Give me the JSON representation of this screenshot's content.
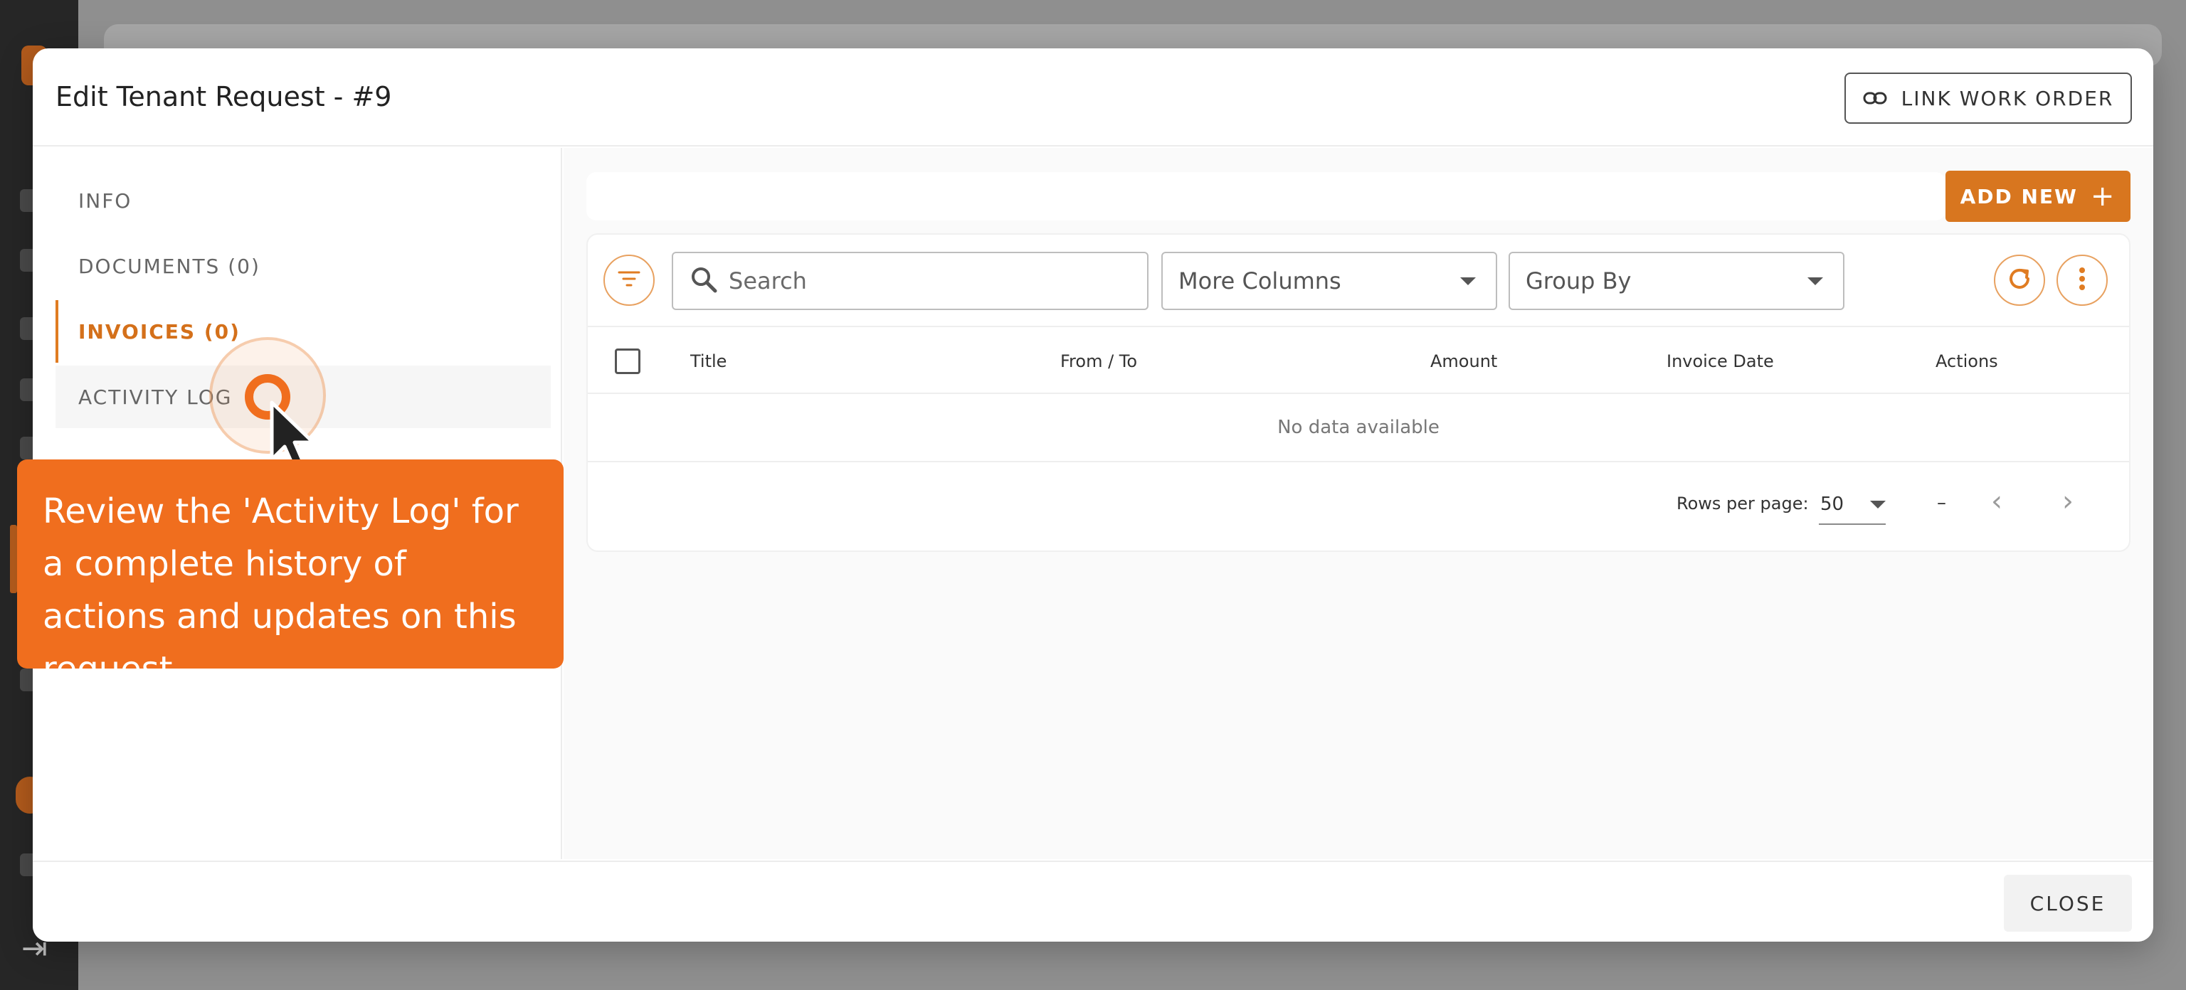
{
  "modal": {
    "title": "Edit Tenant Request - #9",
    "link_work_order": "LINK WORK ORDER",
    "close": "CLOSE"
  },
  "tabs": [
    {
      "label": "INFO"
    },
    {
      "label": "DOCUMENTS (0)"
    },
    {
      "label": "INVOICES (0)",
      "active": true
    },
    {
      "label": "ACTIVITY LOG"
    }
  ],
  "toolbar": {
    "add_new": "ADD NEW",
    "search_placeholder": "Search",
    "more_columns": "More Columns",
    "group_by": "Group By"
  },
  "table": {
    "columns": [
      "Title",
      "From / To",
      "Amount",
      "Invoice Date",
      "Actions"
    ],
    "empty_text": "No data available"
  },
  "pagination": {
    "rows_per_page_label": "Rows per page:",
    "rows_per_page": "50",
    "range": "–"
  },
  "tour": {
    "tooltip_text": "Review the 'Activity Log' for a complete history of actions and updates on this request."
  },
  "colors": {
    "accent": "#e07c22",
    "tooltip": "#f06e1e"
  }
}
